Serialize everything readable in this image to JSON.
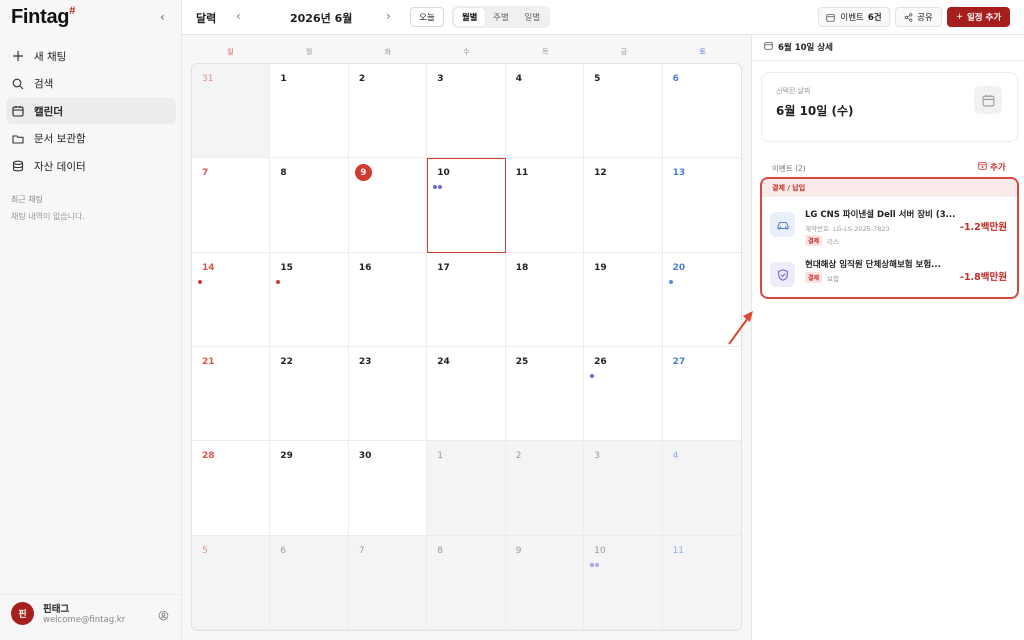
{
  "app": {
    "logo": "Fintag",
    "logo_mark": "#"
  },
  "sidebar": {
    "items": [
      {
        "label": "새 채팅",
        "icon": "plus-icon",
        "active": false
      },
      {
        "label": "검색",
        "icon": "search-icon",
        "active": false
      },
      {
        "label": "캘린더",
        "icon": "calendar-icon",
        "active": true
      },
      {
        "label": "문서 보관함",
        "icon": "folder-icon",
        "active": false
      },
      {
        "label": "자산 데이터",
        "icon": "database-icon",
        "active": false
      }
    ],
    "recent_title": "최근 채팅",
    "recent_empty": "채팅 내역이 없습니다.",
    "user": {
      "avatar": "핀",
      "name": "핀태그",
      "email": "welcome@fintag.kr"
    }
  },
  "header": {
    "title": "달력",
    "month": "2026년 6월",
    "today": "오늘",
    "views": [
      {
        "label": "월별",
        "active": true
      },
      {
        "label": "주별",
        "active": false
      },
      {
        "label": "일별",
        "active": false
      }
    ],
    "events_label": "이벤트",
    "events_count": "6건",
    "share": "공유",
    "add": "일정 추가"
  },
  "calendar": {
    "weekdays": [
      "일",
      "월",
      "화",
      "수",
      "목",
      "금",
      "토"
    ],
    "cells": [
      {
        "day": "31",
        "out": true,
        "dots": []
      },
      {
        "day": "1",
        "out": false,
        "dots": []
      },
      {
        "day": "2",
        "out": false,
        "dots": []
      },
      {
        "day": "3",
        "out": false,
        "dots": []
      },
      {
        "day": "4",
        "out": false,
        "dots": []
      },
      {
        "day": "5",
        "out": false,
        "dots": []
      },
      {
        "day": "6",
        "out": false,
        "dots": []
      },
      {
        "day": "7",
        "out": false,
        "dots": []
      },
      {
        "day": "8",
        "out": false,
        "dots": []
      },
      {
        "day": "9",
        "out": false,
        "today": true,
        "dots": []
      },
      {
        "day": "10",
        "out": false,
        "selected": true,
        "dots": [
          "#5b6fd6",
          "#7a62d8"
        ]
      },
      {
        "day": "11",
        "out": false,
        "dots": []
      },
      {
        "day": "12",
        "out": false,
        "dots": []
      },
      {
        "day": "13",
        "out": false,
        "dots": []
      },
      {
        "day": "14",
        "out": false,
        "dots": [
          "#d23a34"
        ]
      },
      {
        "day": "15",
        "out": false,
        "dots": [
          "#d23a34"
        ]
      },
      {
        "day": "16",
        "out": false,
        "dots": []
      },
      {
        "day": "17",
        "out": false,
        "dots": []
      },
      {
        "day": "18",
        "out": false,
        "dots": []
      },
      {
        "day": "19",
        "out": false,
        "dots": []
      },
      {
        "day": "20",
        "out": false,
        "dots": [
          "#4a8fe0"
        ]
      },
      {
        "day": "21",
        "out": false,
        "dots": []
      },
      {
        "day": "22",
        "out": false,
        "dots": []
      },
      {
        "day": "23",
        "out": false,
        "dots": []
      },
      {
        "day": "24",
        "out": false,
        "dots": []
      },
      {
        "day": "25",
        "out": false,
        "dots": []
      },
      {
        "day": "26",
        "out": false,
        "dots": [
          "#7a62d8"
        ]
      },
      {
        "day": "27",
        "out": false,
        "dots": []
      },
      {
        "day": "28",
        "out": false,
        "dots": []
      },
      {
        "day": "29",
        "out": false,
        "dots": []
      },
      {
        "day": "30",
        "out": false,
        "dots": []
      },
      {
        "day": "1",
        "out": true,
        "dots": []
      },
      {
        "day": "2",
        "out": true,
        "dots": []
      },
      {
        "day": "3",
        "out": true,
        "dots": []
      },
      {
        "day": "4",
        "out": true,
        "dots": []
      },
      {
        "day": "5",
        "out": true,
        "dots": []
      },
      {
        "day": "6",
        "out": true,
        "dots": []
      },
      {
        "day": "7",
        "out": true,
        "dots": []
      },
      {
        "day": "8",
        "out": true,
        "dots": []
      },
      {
        "day": "9",
        "out": true,
        "dots": []
      },
      {
        "day": "10",
        "out": true,
        "dots": [
          "#9aa6e6",
          "#b3a6e8"
        ]
      },
      {
        "day": "11",
        "out": true,
        "dots": []
      }
    ]
  },
  "panel": {
    "title": "6월 10일 상세",
    "selected_label": "선택된 날짜",
    "selected_date": "6월 10일 (수)",
    "events_title": "이벤트 (2)",
    "add": "추가",
    "category": "결제 / 납입",
    "events": [
      {
        "name": "LG CNS 파이낸셜 Dell 서버 장비 (3...",
        "sub": "계약번호: LG-LS-2025-7823",
        "tag": "결제",
        "type": "리스",
        "amount": "-1.2백만원",
        "icon": "car-icon",
        "icon_bg": "#e9f0fb",
        "icon_color": "#5a7fc7"
      },
      {
        "name": "현대해상 임직원 단체상해보험 보험...",
        "sub": "",
        "tag": "결제",
        "type": "보험",
        "amount": "-1.8백만원",
        "icon": "shield-icon",
        "icon_bg": "#efebfb",
        "icon_color": "#7a62d8"
      }
    ]
  },
  "colors": {
    "brand": "#a5201c",
    "accent_red": "#d23a34",
    "saturday": "#4a7fd6"
  }
}
